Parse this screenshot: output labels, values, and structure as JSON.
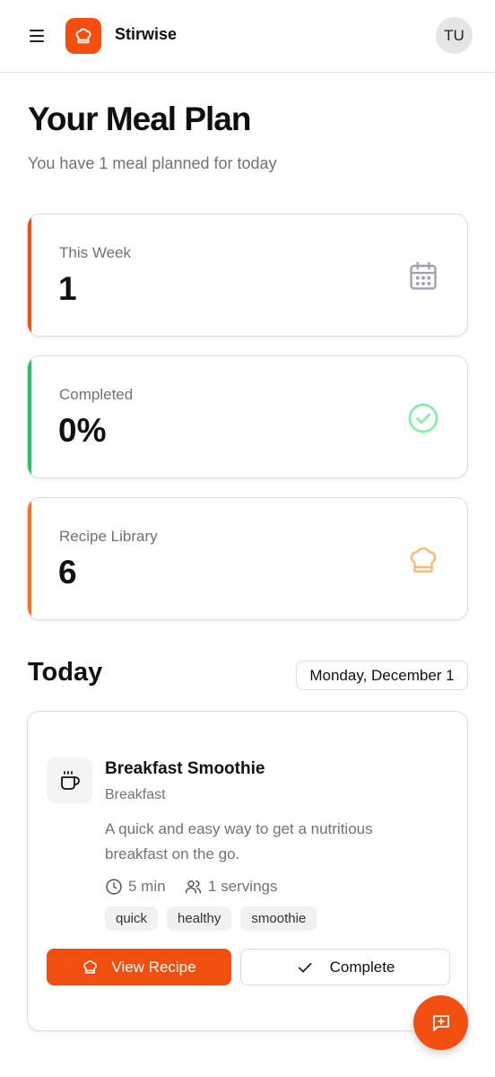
{
  "header": {
    "brand_name": "Stirwise",
    "avatar_initials": "TU",
    "brand_color": "#f24e0f"
  },
  "page": {
    "title": "Your Meal Plan",
    "subtitle": "You have 1 meal planned for today"
  },
  "stats": [
    {
      "label": "This Week",
      "value": "1",
      "accent": "#f24e0f",
      "icon": "calendar-icon"
    },
    {
      "label": "Completed",
      "value": "0%",
      "accent": "#22c55e",
      "icon": "check-circle-icon"
    },
    {
      "label": "Recipe Library",
      "value": "6",
      "accent": "#f97316",
      "icon": "chef-hat-icon"
    }
  ],
  "today": {
    "title": "Today",
    "date": "Monday, December 1"
  },
  "meal": {
    "icon": "coffee-cup-icon",
    "name": "Breakfast Smoothie",
    "type": "Breakfast",
    "description": "A quick and easy way to get a nutritious breakfast on the go.",
    "time": "5 min",
    "servings": "1 servings",
    "tags": [
      "quick",
      "healthy",
      "smoothie"
    ],
    "view_label": "View Recipe",
    "complete_label": "Complete"
  },
  "fab": {
    "icon": "add-message-icon"
  }
}
